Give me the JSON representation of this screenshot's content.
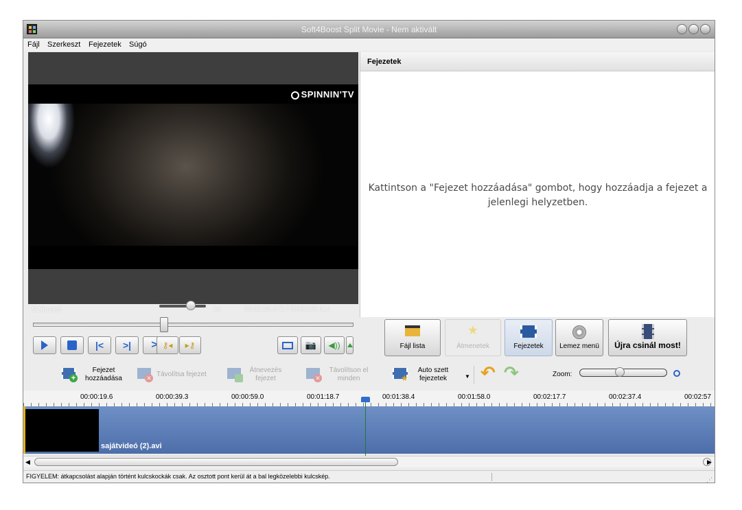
{
  "window": {
    "title": "Soft4Boost Split Movie - Nem aktivált"
  },
  "menu": [
    {
      "label": "Fájl"
    },
    {
      "label": "Szerkeszt"
    },
    {
      "label": "Fejezetek"
    },
    {
      "label": "Súgó"
    }
  ],
  "video": {
    "watermark": "SPINNIN'TV"
  },
  "player": {
    "state_label": "Szünetel",
    "speed": "1x",
    "position": "00:01:29.071",
    "separator": "/",
    "duration": "00:03:39.614",
    "seek_fraction": 0.41
  },
  "chapters_panel": {
    "header": "Fejezetek",
    "empty_message": "Kattintson a \"Fejezet hozzáadása\" gombot, hogy hozzáadja a fejezet a jelenlegi helyzetben."
  },
  "mode_buttons": [
    {
      "label": "Fájl lista",
      "icon": "clapperboard-icon"
    },
    {
      "label": "Átmenetek",
      "icon": "star-icon"
    },
    {
      "label": "Fejezetek",
      "icon": "filmstrip-icon"
    },
    {
      "label": "Lemez menü",
      "icon": "disc-icon"
    },
    {
      "label": "Újra csinál most!",
      "icon": "film-render-icon"
    }
  ],
  "toolbar": {
    "add_chapter": "Fejezet hozzáadása",
    "remove_chapter": "Távolítsa fejezet",
    "rename_chapter": "Átnevezés fejezet",
    "remove_all": "Távolítson el minden",
    "auto_chapters": "Auto szett fejezetek",
    "zoom_label": "Zoom:"
  },
  "timeline": {
    "ticks": [
      "00:00:19.6",
      "00:00:39.3",
      "00:00:59.0",
      "00:01:18.7",
      "00:01:38.4",
      "00:01:58.0",
      "00:02:17.7",
      "00:02:37.4",
      "00:02:57"
    ],
    "clip_name": "sajátvideó (2).avi"
  },
  "status": {
    "text": "FIGYELEM: átkapcsolást alapján történt kulcskockák csak. Az osztott pont kerül át a bal legközelebbi kulcskép."
  },
  "colors": {
    "accent_blue": "#2a63c8",
    "track_blue": "#5a7cb8",
    "disabled_text": "#a9a9a9"
  }
}
